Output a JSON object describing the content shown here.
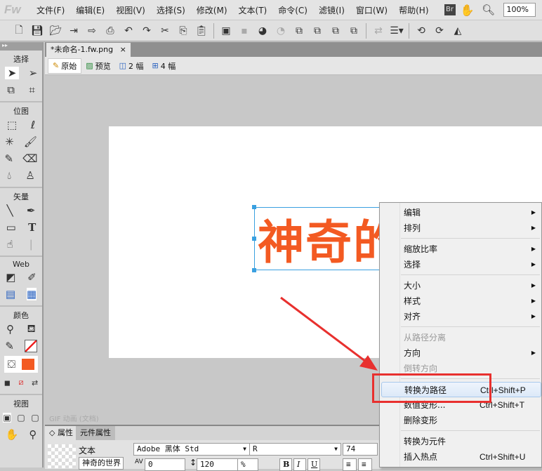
{
  "app": {
    "logo": "Fw",
    "zoom": "100%",
    "bridge": "Br"
  },
  "menu": [
    "文件(F)",
    "编辑(E)",
    "视图(V)",
    "选择(S)",
    "修改(M)",
    "文本(T)",
    "命令(C)",
    "滤镜(I)",
    "窗口(W)",
    "帮助(H)"
  ],
  "document": {
    "tab": "*未命名-1.fw.png",
    "close": "×",
    "views": [
      "原始",
      "预览",
      "2 幅",
      "4 幅"
    ],
    "status": "GIF 动画 (文档)",
    "text": "神奇的世界"
  },
  "tools": {
    "sections": [
      "选择",
      "位图",
      "矢量",
      "Web",
      "颜色",
      "视图"
    ],
    "fill_color": "#f35a22"
  },
  "properties": {
    "tabs": [
      "◇ 属性",
      "元件属性"
    ],
    "type": "文本",
    "name": "神奇的世界",
    "font": "Adobe 黑体 Std",
    "style": "R",
    "size": "74",
    "kerning": "0",
    "leading": "120",
    "leading_unit": "%",
    "bold": "B",
    "italic": "I",
    "underline": "U"
  },
  "context_menu": [
    {
      "label": "编辑",
      "arrow": true
    },
    {
      "label": "排列",
      "arrow": true
    },
    {
      "sep": true
    },
    {
      "label": "缩放比率",
      "arrow": true
    },
    {
      "label": "选择",
      "arrow": true
    },
    {
      "sep": true
    },
    {
      "label": "大小",
      "arrow": true
    },
    {
      "label": "样式",
      "arrow": true
    },
    {
      "label": "对齐",
      "arrow": true
    },
    {
      "sep": true
    },
    {
      "label": "从路径分离",
      "disabled": true
    },
    {
      "label": "方向",
      "arrow": true
    },
    {
      "label": "倒转方向",
      "disabled": true
    },
    {
      "sep": true
    },
    {
      "label": "转换为路径",
      "shortcut": "Ctrl+Shift+P",
      "hover": true
    },
    {
      "label": "数值变形...",
      "shortcut": "Ctrl+Shift+T"
    },
    {
      "label": "删除变形"
    },
    {
      "sep": true
    },
    {
      "label": "转换为元件"
    },
    {
      "label": "插入热点",
      "shortcut": "Ctrl+Shift+U"
    }
  ],
  "annotation_color": "#e8302e"
}
